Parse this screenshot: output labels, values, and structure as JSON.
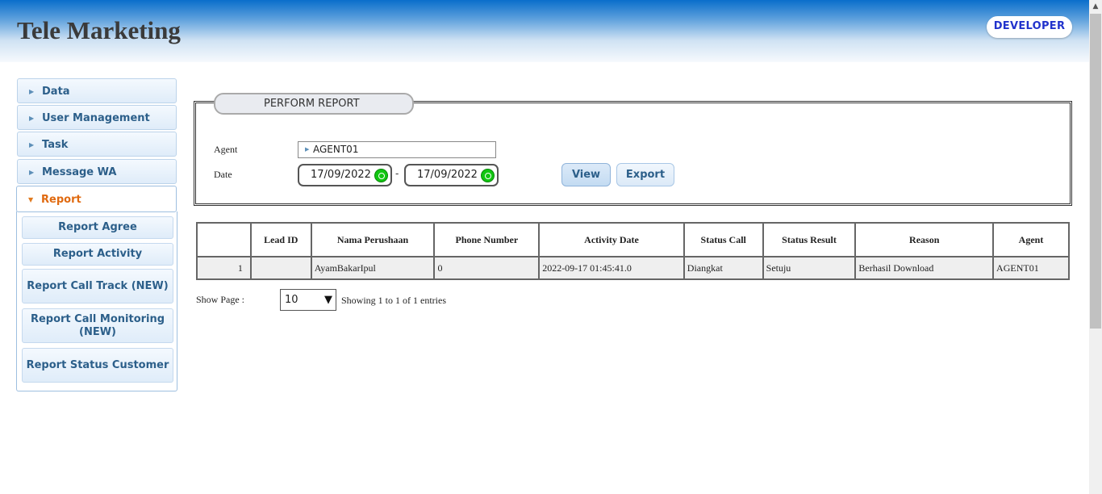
{
  "header": {
    "title": "Tele Marketing",
    "badge": "DEVELOPER"
  },
  "sidebar": {
    "items": [
      {
        "label": "Data"
      },
      {
        "label": "User Management"
      },
      {
        "label": "Task"
      },
      {
        "label": "Message WA"
      },
      {
        "label": "Report",
        "active": true
      }
    ],
    "submenu": [
      {
        "label": "Report Agree"
      },
      {
        "label": "Report Activity"
      },
      {
        "label": "Report Call Track (NEW)"
      },
      {
        "label": "Report Call Monitoring (NEW)"
      },
      {
        "label": "Report Status Customer"
      }
    ]
  },
  "form": {
    "legend": "PERFORM REPORT",
    "agent_label": "Agent",
    "agent_value": "AGENT01",
    "date_label": "Date",
    "date_from": "17/09/2022",
    "date_separator": "-",
    "date_to": "17/09/2022",
    "view_label": "View",
    "export_label": "Export"
  },
  "table": {
    "headers": [
      "",
      "Lead ID",
      "Nama Perushaan",
      "Phone Number",
      "Activity Date",
      "Status Call",
      "Status Result",
      "Reason",
      "Agent"
    ],
    "rows": [
      [
        "1",
        "",
        "AyamBakarIpul",
        "0",
        "2022-09-17 01:45:41.0",
        "Diangkat",
        "Setuju",
        "Berhasil Download",
        "AGENT01"
      ]
    ]
  },
  "pagination": {
    "show_label": "Show Page :",
    "page_size": "10",
    "summary": "Showing 1 to 1 of 1 entries"
  }
}
